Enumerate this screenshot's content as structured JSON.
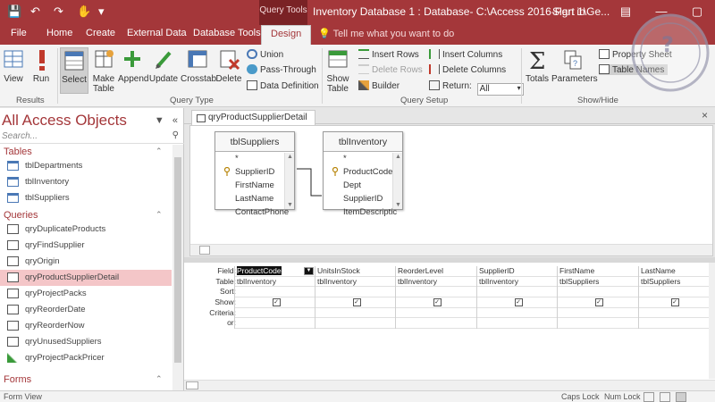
{
  "titlebar": {
    "context_tab": "Query Tools",
    "title": "Inventory Database 1 : Database- C:\\Access 2016-Part 1\\Ge...",
    "sign_in": "Sign in"
  },
  "tabs": [
    {
      "label": "File"
    },
    {
      "label": "Home"
    },
    {
      "label": "Create"
    },
    {
      "label": "External Data"
    },
    {
      "label": "Database Tools"
    },
    {
      "label": "Design"
    }
  ],
  "active_tab": "Design",
  "tell_me": "Tell me what you want to do",
  "ribbon": {
    "results": {
      "label": "Results",
      "view": "View",
      "run": "Run"
    },
    "query_type": {
      "label": "Query Type",
      "select": "Select",
      "make_table": "Make\nTable",
      "append": "Append",
      "update": "Update",
      "crosstab": "Crosstab",
      "delete": "Delete",
      "union": "Union",
      "pass_through": "Pass-Through",
      "data_definition": "Data Definition"
    },
    "query_setup": {
      "label": "Query Setup",
      "show_table": "Show\nTable",
      "insert_rows": "Insert Rows",
      "delete_rows": "Delete Rows",
      "builder": "Builder",
      "insert_columns": "Insert Columns",
      "delete_columns": "Delete Columns",
      "return_label": "Return:",
      "return_value": "All"
    },
    "show_hide": {
      "label": "Show/Hide",
      "totals": "Totals",
      "parameters": "Parameters",
      "property_sheet": "Property Sheet",
      "table_names": "Table Names"
    }
  },
  "nav": {
    "title": "All Access Objects",
    "search_placeholder": "Search...",
    "sections": [
      {
        "label": "Tables",
        "items": [
          "tblDepartments",
          "tblInventory",
          "tblSuppliers"
        ]
      },
      {
        "label": "Queries",
        "items": [
          "qryDuplicateProducts",
          "qryFindSupplier",
          "qryOrigin",
          "qryProductSupplierDetail",
          "qryProjectPacks",
          "qryReorderDate",
          "qryReorderNow",
          "qryUnusedSuppliers",
          "qryProjectPackPricer"
        ]
      },
      {
        "label": "Forms",
        "items": []
      }
    ],
    "active_item": "qryProductSupplierDetail"
  },
  "document": {
    "tab": "qryProductSupplierDetail",
    "tables": [
      {
        "name": "tblSuppliers",
        "fields": [
          "*",
          "SupplierID",
          "FirstName",
          "LastName",
          "ContactPhone"
        ],
        "key": "SupplierID"
      },
      {
        "name": "tblInventory",
        "fields": [
          "*",
          "ProductCode",
          "Dept",
          "SupplierID",
          "ItemDescriptic"
        ],
        "key": "ProductCode"
      }
    ]
  },
  "grid": {
    "row_labels": [
      "Field:",
      "Table:",
      "Sort:",
      "Show:",
      "Criteria:",
      "or:"
    ],
    "columns": [
      {
        "field": "ProductCode",
        "table": "tblInventory",
        "show": true
      },
      {
        "field": "UnitsInStock",
        "table": "tblInventory",
        "show": true
      },
      {
        "field": "ReorderLevel",
        "table": "tblInventory",
        "show": true
      },
      {
        "field": "SupplierID",
        "table": "tblInventory",
        "show": true
      },
      {
        "field": "FirstName",
        "table": "tblSuppliers",
        "show": true
      },
      {
        "field": "LastName",
        "table": "tblSuppliers",
        "show": true
      }
    ]
  },
  "status": {
    "left": "Form View",
    "caps": "Caps Lock",
    "num": "Num Lock"
  },
  "colors": {
    "accent": "#a4373a",
    "ribbon": "#f3f3f3",
    "active_nav": "#f4c6c8"
  }
}
